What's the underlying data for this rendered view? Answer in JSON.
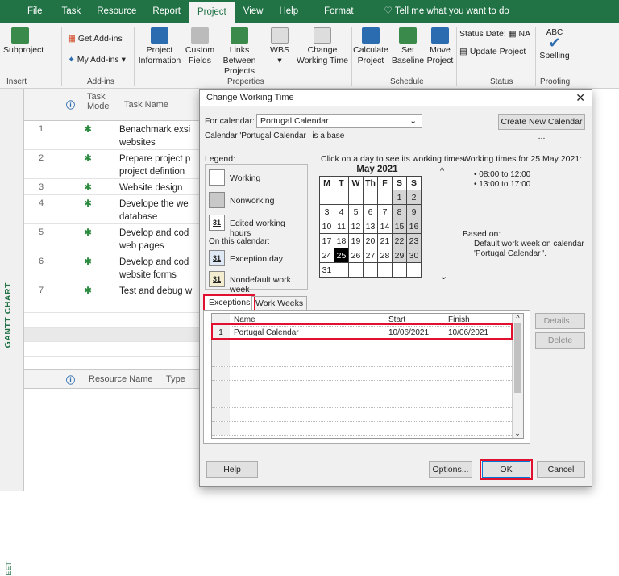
{
  "ribbon": {
    "tabs": [
      "File",
      "Task",
      "Resource",
      "Report",
      "Project",
      "View",
      "Help",
      "Format"
    ],
    "active_tab": "Project",
    "tell_me": "Tell me what you want to do",
    "buttons": {
      "subproject": "Subproject",
      "get_addins": "Get Add-ins",
      "my_addins": "My Add-ins",
      "project_info": "Project Information",
      "custom_fields": "Custom Fields",
      "links": "Links Between Projects",
      "wbs": "WBS",
      "change_wt": "Change Working Time",
      "calculate": "Calculate Project",
      "set_baseline": "Set Baseline",
      "move_project": "Move Project",
      "status_date": "Status Date:",
      "status_date_value": "NA",
      "update_project": "Update Project",
      "spelling": "Spelling",
      "abc": "ABC"
    },
    "groups": {
      "insert": "Insert",
      "addins": "Add-ins",
      "properties": "Properties",
      "schedule": "Schedule",
      "status": "Status",
      "proofing": "Proofing"
    }
  },
  "sidebar": {
    "gantt": "GANTT CHART",
    "sheet": "EET"
  },
  "grid": {
    "col_mode": "Task Mode",
    "col_name": "Task Name",
    "rows": [
      {
        "num": "1",
        "name": "Benachmark exsi",
        "name2": "websites"
      },
      {
        "num": "2",
        "name": "Prepare project p",
        "name2": "project defintion"
      },
      {
        "num": "3",
        "name": "Website design",
        "name2": ""
      },
      {
        "num": "4",
        "name": "Develope the we",
        "name2": "database"
      },
      {
        "num": "5",
        "name": "Develop and cod",
        "name2": "web pages"
      },
      {
        "num": "6",
        "name": "Develop and cod",
        "name2": "website forms"
      },
      {
        "num": "7",
        "name": "Test and debug w",
        "name2": ""
      }
    ],
    "res_name": "Resource Name",
    "res_type": "Type"
  },
  "dialog": {
    "title": "Change Working Time",
    "close": "✕",
    "for_calendar_label": "For calendar:",
    "for_calendar_value": "Portugal Calendar",
    "base_text": "Calendar 'Portugal Calendar ' is a base",
    "create_new": "Create New Calendar ...",
    "legend_title": "Legend:",
    "legend": {
      "working": "Working",
      "nonworking": "Nonworking",
      "edited": "Edited working hours",
      "on_this": "On this calendar:",
      "exception": "Exception day",
      "nondefault": "Nondefault work week",
      "num": "31"
    },
    "click_day": "Click on a day to see its working times:",
    "month": "May 2021",
    "weekdays": [
      "M",
      "T",
      "W",
      "Th",
      "F",
      "S",
      "S"
    ],
    "weeks": [
      [
        "",
        "",
        "",
        "",
        "",
        "1",
        "2"
      ],
      [
        "3",
        "4",
        "5",
        "6",
        "7",
        "8",
        "9"
      ],
      [
        "10",
        "11",
        "12",
        "13",
        "14",
        "15",
        "16"
      ],
      [
        "17",
        "18",
        "19",
        "20",
        "21",
        "22",
        "23"
      ],
      [
        "24",
        "25",
        "26",
        "27",
        "28",
        "29",
        "30"
      ],
      [
        "31",
        "",
        "",
        "",
        "",
        "",
        ""
      ]
    ],
    "working_times_title": "Working times for 25 May 2021:",
    "times": [
      "• 08:00 to 12:00",
      "• 13:00 to 17:00"
    ],
    "based_on": "Based on:",
    "based_on_text": "Default work week on calendar 'Portugal Calendar '.",
    "tabs": {
      "exceptions": "Exceptions",
      "work_weeks": "Work Weeks"
    },
    "table": {
      "col_name": "Name",
      "col_start": "Start",
      "col_finish": "Finish",
      "rows": [
        {
          "num": "1",
          "name": "Portugal Calendar",
          "start": "10/06/2021",
          "finish": "10/06/2021"
        }
      ]
    },
    "details": "Details...",
    "delete": "Delete",
    "help": "Help",
    "options": "Options...",
    "ok": "OK",
    "cancel": "Cancel"
  }
}
